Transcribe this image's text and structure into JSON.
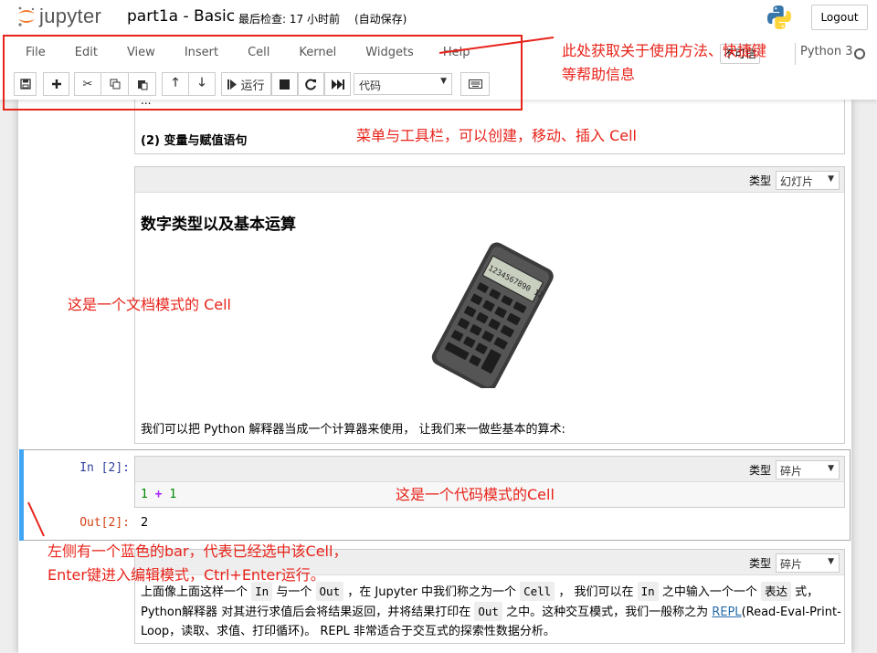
{
  "header": {
    "logo_text": "jupyter",
    "notebook_title": "part1a - Basic",
    "checkpoint": "最后检查: 17 小时前",
    "autosave": "(自动保存)",
    "logout_label": "Logout"
  },
  "menubar": {
    "items": [
      "File",
      "Edit",
      "View",
      "Insert",
      "Cell",
      "Kernel",
      "Widgets",
      "Help"
    ],
    "trusted_label": "不可信",
    "kernel_name": "Python 3"
  },
  "toolbar": {
    "run_label": "运行",
    "cell_type_value": "代码",
    "buttons": [
      "save-icon",
      "plus-icon",
      "cut-icon",
      "copy-icon",
      "paste-icon",
      "arrow-up-icon",
      "arrow-down-icon",
      "step-forward-icon",
      "stop-icon",
      "refresh-icon",
      "fast-forward-icon",
      "keyboard-icon"
    ]
  },
  "cells": {
    "partial_top": {
      "text": "(2) 变量与赋值语句",
      "bullet": "..."
    },
    "slide_cell": {
      "type_label": "类型",
      "type_value": "幻灯片",
      "heading": "数字类型以及基本运算",
      "calculator_display": "1234567890 12",
      "paragraph": "我们可以把 Python 解释器当成一个计算器来使用， 让我们来一做些基本的算术:"
    },
    "code_cell": {
      "in_prompt": "In [2]:",
      "out_prompt": "Out[2]:",
      "type_label": "类型",
      "type_value": "碎片",
      "code_left": "1",
      "code_op": "+",
      "code_right": "1",
      "output": "2"
    },
    "bottom_cell": {
      "type_label": "类型",
      "type_value": "碎片",
      "t1": "上面像上面这样一个",
      "c1": "In",
      "t2": "与一个",
      "c2": "Out",
      "t3": "，在 Jupyter 中我们称之为一个",
      "c3": "Cell",
      "t4": "， 我们可以在",
      "c4": "In",
      "t5": "之中输入一个一个",
      "c5": "表达",
      "t6": "式，Python解释器 对其进行求值后会将结果返回，并将结果打印在",
      "c6": "Out",
      "t7": "之中。这种交互模式，我们一般称之为",
      "link": "REPL",
      "t8": "(Read-Eval-Print-Loop，读取、求值、打印循环)。 REPL 非常适合于交互式的探索性数据分析。"
    }
  },
  "annotations": {
    "help": "此处获取关于使用方法、快捷键",
    "help2": "等帮助信息",
    "menu": "菜单与工具栏，可以创建，移动、插入 Cell",
    "doc": "这是一个文档模式的 Cell",
    "code": "这是一个代码模式的Cell",
    "bar1": "左侧有一个蓝色的bar，代表已经选中该Cell，",
    "bar2": "Enter键进入编辑模式，Ctrl+Enter运行。"
  },
  "colors": {
    "annotation": "#e8231a",
    "selected_bar": "#42a5f5",
    "prompt_in": "#303f9f",
    "prompt_out": "#d84315",
    "link": "#296eaa"
  }
}
